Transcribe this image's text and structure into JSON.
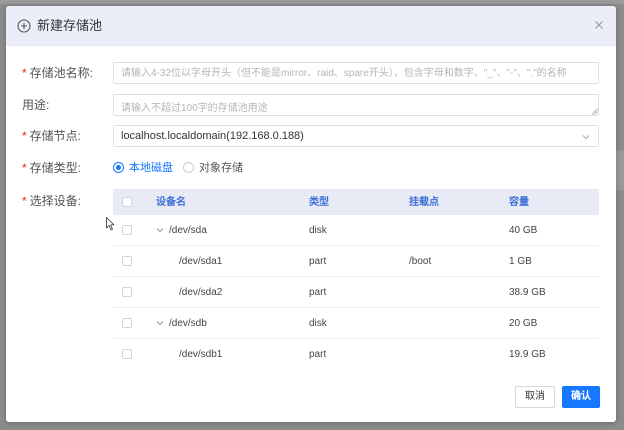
{
  "dialog": {
    "title": "新建存储池",
    "header_icon": "plus-circle-icon",
    "close_icon": "close-icon"
  },
  "form": {
    "pool_name": {
      "label": "存储池名称:",
      "required": true,
      "value": "",
      "placeholder": "请输入4-32位以字母开头（但不能是mirror、raid、spare开头），包含字母和数字、\"_\"、\"-\"、\".\"的名称"
    },
    "purpose": {
      "label": "用途:",
      "required": false,
      "value": "",
      "placeholder": "请输入不超过100字的存储池用途"
    },
    "node": {
      "label": "存储节点:",
      "required": true,
      "selected": "localhost.localdomain(192.168.0.188)",
      "arrow_icon": "chevron-down-icon"
    },
    "storage_type": {
      "label": "存储类型:",
      "required": true,
      "options": [
        {
          "label": "本地磁盘",
          "checked": true
        },
        {
          "label": "对象存储",
          "checked": false
        }
      ]
    },
    "devices": {
      "label": "选择设备:",
      "required": true,
      "columns": [
        "设备名",
        "类型",
        "挂载点",
        "容量"
      ],
      "rows": [
        {
          "name": "/dev/sda",
          "type": "disk",
          "mount": "",
          "size": "40 GB",
          "level": 0,
          "expanded": true
        },
        {
          "name": "/dev/sda1",
          "type": "part",
          "mount": "/boot",
          "size": "1 GB",
          "level": 1
        },
        {
          "name": "/dev/sda2",
          "type": "part",
          "mount": "",
          "size": "38.9 GB",
          "level": 1
        },
        {
          "name": "/dev/sdb",
          "type": "disk",
          "mount": "",
          "size": "20 GB",
          "level": 0,
          "expanded": true
        },
        {
          "name": "/dev/sdb1",
          "type": "part",
          "mount": "",
          "size": "19.9 GB",
          "level": 1
        }
      ]
    }
  },
  "footer": {
    "cancel_label": "取消",
    "ok_label": "确认"
  },
  "colors": {
    "accent": "#1677ff",
    "header_bg": "#ebedf8",
    "table_head_bg": "#e8ebf5",
    "required": "#f5222d"
  }
}
